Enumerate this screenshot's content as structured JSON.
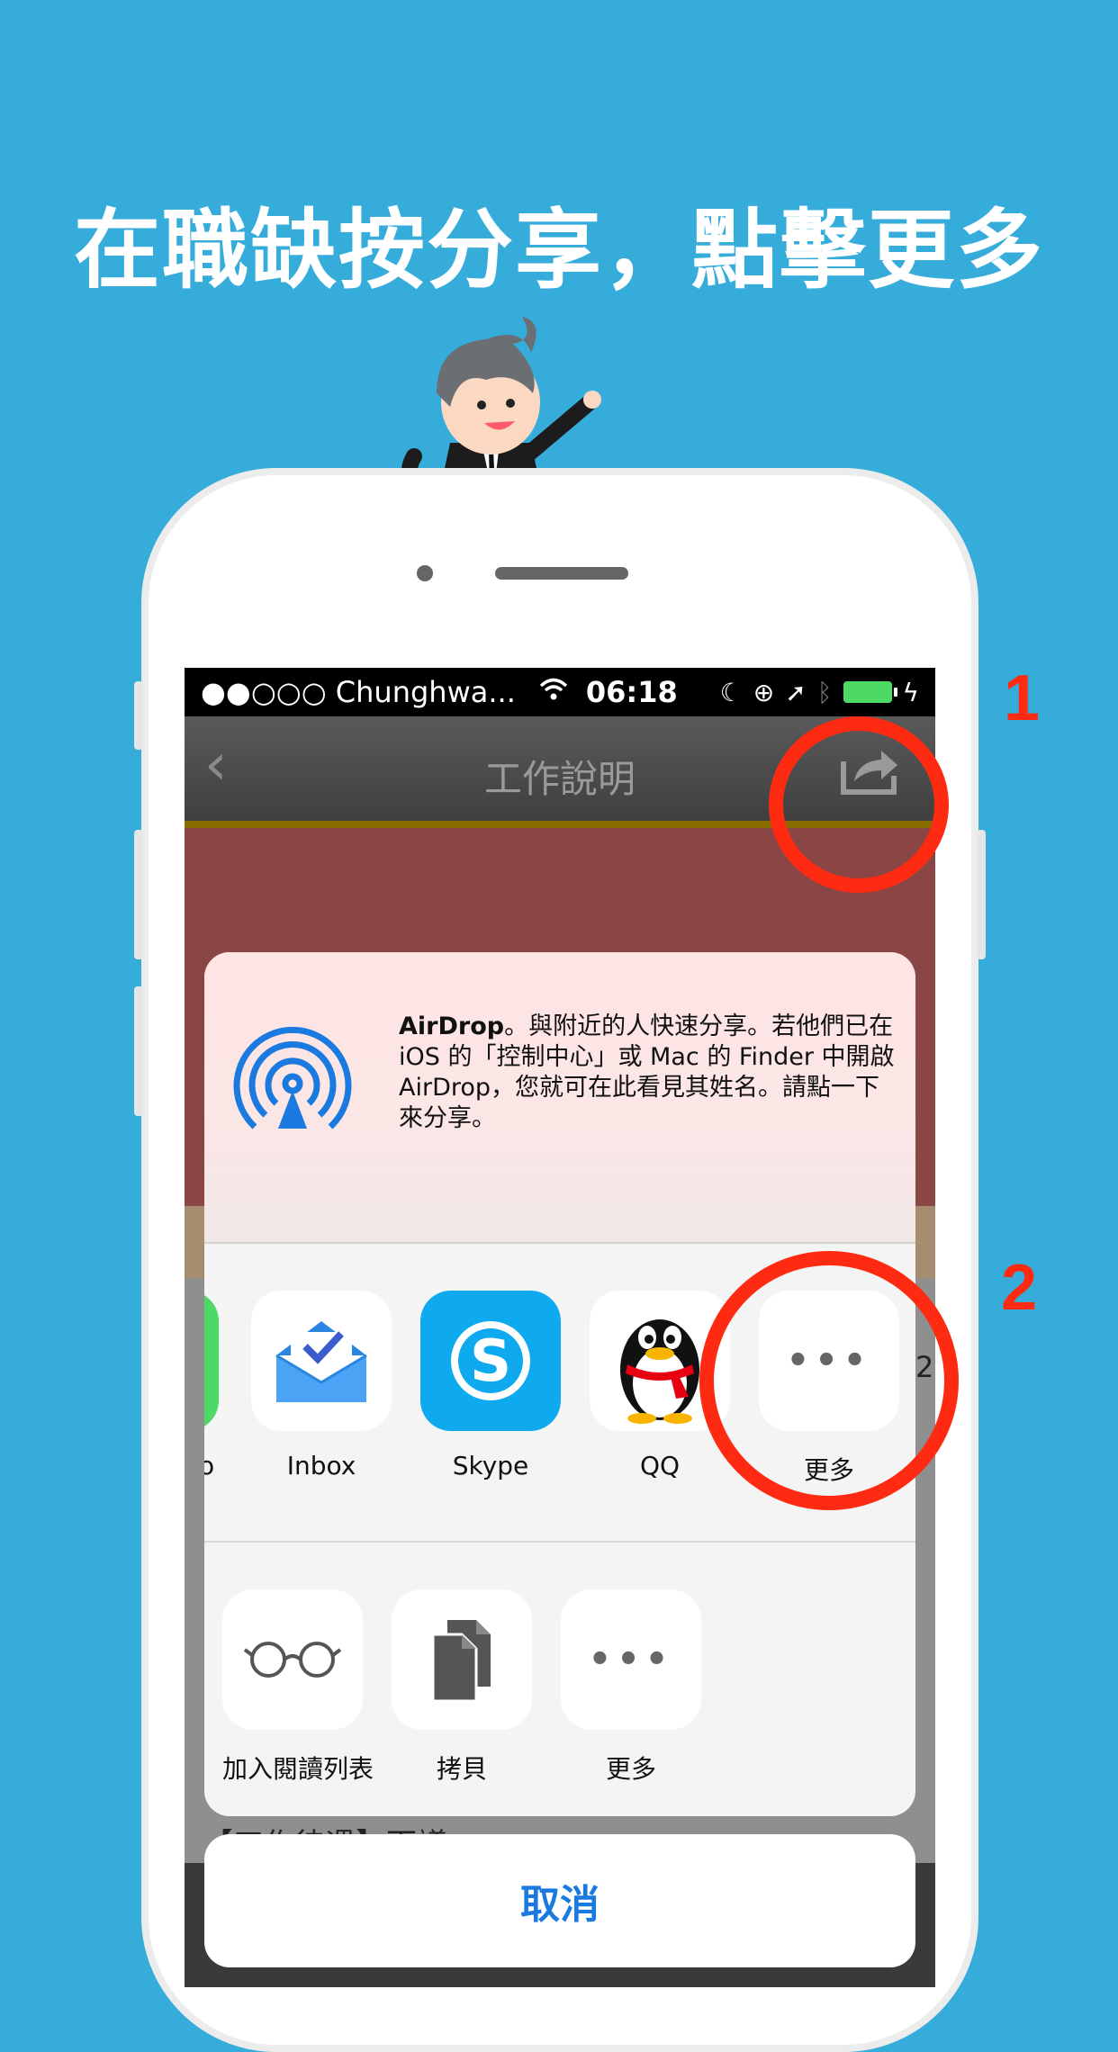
{
  "headline": "在職缺按分享，點擊更多",
  "status_bar": {
    "carrier": "●●○○○ Chunghwa...",
    "time": "06:18"
  },
  "nav": {
    "title": "工作說明"
  },
  "airdrop": {
    "title": "AirDrop",
    "text": "。與附近的人快速分享。若他們已在 iOS 的「控制中心」或 Mac 的 Finder 中開啟 AirDrop，您就可在此看見其姓名。請點一下來分享。"
  },
  "share_apps": [
    {
      "label": "o"
    },
    {
      "label": "Inbox",
      "icon": "inbox-icon"
    },
    {
      "label": "Skype",
      "icon": "skype-icon"
    },
    {
      "label": "QQ",
      "icon": "qq-penguin-icon"
    },
    {
      "label": "更多",
      "icon": "more-dots-icon"
    }
  ],
  "share_actions": [
    {
      "label": "加入閱讀列表",
      "icon": "glasses-icon"
    },
    {
      "label": "拷貝",
      "icon": "copy-icon"
    },
    {
      "label": "更多",
      "icon": "more-dots-icon"
    }
  ],
  "edge_partial": "2",
  "underlying_text": "【工作待遇】面議",
  "cancel_label": "取消",
  "annotations": {
    "step1": "1",
    "step2": "2"
  },
  "colors": {
    "background": "#36acdb",
    "annotation": "#ff2a12",
    "ios_blue": "#1a7ae0"
  }
}
